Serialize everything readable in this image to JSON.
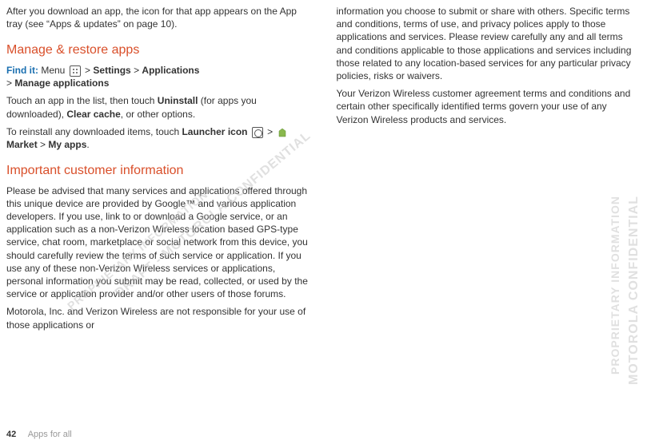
{
  "left": {
    "intro": "After you download an app, the icon for that app appears on the App tray (see “Apps & updates” on page 10).",
    "manage_heading": "Manage & restore apps",
    "findit_label": "Find it:",
    "findit_menu": "Menu",
    "findit_settings": "Settings",
    "findit_applications": "Applications",
    "findit_manage": "Manage applications",
    "gt": " > ",
    "touch_pre": "Touch an app in the list, then touch ",
    "uninstall": "Uninstall",
    "touch_mid": " (for apps you downloaded), ",
    "clearcache": "Clear cache",
    "touch_post": ", or other options.",
    "reinstall_pre": "To reinstall any downloaded items, touch ",
    "launcher_icon": "Launcher icon",
    "market": "Market",
    "myapps": "My apps",
    "period": ".",
    "important_heading": "Important customer information",
    "advice": "Please be advised that many services and applications offered through this unique device are provided by Google™ and various application developers. If you use, link to or download a Google service, or an application such as a non-Verizon Wireless location based GPS-type service, chat room, marketplace or social network from this device, you should carefully review the terms of such service or application. If you use any of these non-Verizon Wireless services or applications, personal information you submit may be read, collected, or used by the service or application provider and/or other users of those forums.",
    "moto": "Motorola, Inc. and Verizon Wireless are not responsible for your use of those applications or"
  },
  "right": {
    "p1": "information you choose to submit or share with others. Specific terms and conditions, terms of use, and privacy polices apply to those applications and services. Please review carefully any and all terms and conditions applicable to those applications and services including those related to any location-based services for any particular privacy policies, risks or waivers.",
    "p2": "Your Verizon Wireless customer agreement terms and conditions and certain other specifically identified terms govern your use of any Verizon Wireless products and services."
  },
  "footer": {
    "page": "42",
    "section": "Apps for all"
  },
  "watermarks": {
    "conf": "MOTOROLA CONFIDENTIAL",
    "prop": "PROPRIETARY INFORMATION",
    "draft": "DRAFT - MOTOROLA CONFIDENTIAL",
    "prop2": "PROPRIETARY INFORMATION"
  }
}
